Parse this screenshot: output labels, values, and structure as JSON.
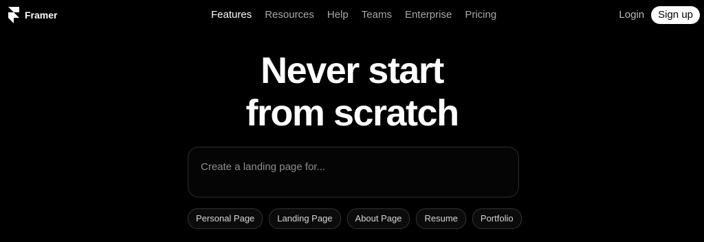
{
  "brand": {
    "name": "Framer",
    "logo_icon": "framer-logo-icon"
  },
  "nav": {
    "links": [
      {
        "label": "Features",
        "active": true
      },
      {
        "label": "Resources",
        "active": false
      },
      {
        "label": "Help",
        "active": false
      },
      {
        "label": "Teams",
        "active": false
      },
      {
        "label": "Enterprise",
        "active": false
      },
      {
        "label": "Pricing",
        "active": false
      }
    ],
    "login_label": "Login",
    "signup_label": "Sign up"
  },
  "hero": {
    "title_line1": "Never start",
    "title_line2": "from scratch"
  },
  "prompt": {
    "placeholder": "Create a landing page for...",
    "value": ""
  },
  "suggestions": [
    "Personal Page",
    "Landing Page",
    "About Page",
    "Resume",
    "Portfolio"
  ],
  "colors": {
    "background": "#000000",
    "text": "#ffffff",
    "nav_muted": "#a8a8a8",
    "signup_bg": "#ffffff",
    "border": "#2c2c2c"
  }
}
